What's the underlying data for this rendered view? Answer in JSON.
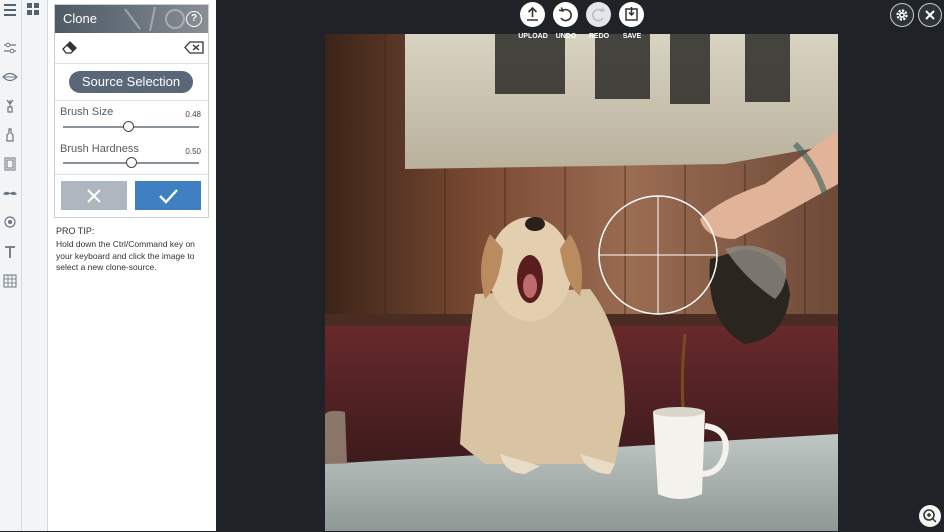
{
  "rail_icons": [
    "menu-icon",
    "adjust-sliders-icon",
    "eye-icon",
    "brush-icon",
    "paint-bottle-icon",
    "frame-icon",
    "mustache-icon",
    "sticker-icon",
    "text-icon",
    "texture-icon"
  ],
  "panel": {
    "title": "Clone",
    "help_label": "?",
    "source_selection_label": "Source Selection",
    "brush_size_label": "Brush Size",
    "brush_size_value": "0.48",
    "brush_size_fraction": 0.48,
    "brush_hardness_label": "Brush Hardness",
    "brush_hardness_value": "0.50",
    "brush_hardness_fraction": 0.5,
    "pro_tip_title": "PRO TIP:",
    "pro_tip_text": "Hold down the Ctrl/Command key on your keyboard and click the image to select a new clone-source."
  },
  "toolbar": {
    "upload_label": "UPLOAD",
    "undo_label": "UNDO",
    "redo_label": "REDO",
    "save_label": "SAVE"
  },
  "colors": {
    "accent": "#3f7fc2",
    "source_button": "#5a6778",
    "cancel": "#aeb7c0",
    "canvas_bg": "#1f2327"
  }
}
